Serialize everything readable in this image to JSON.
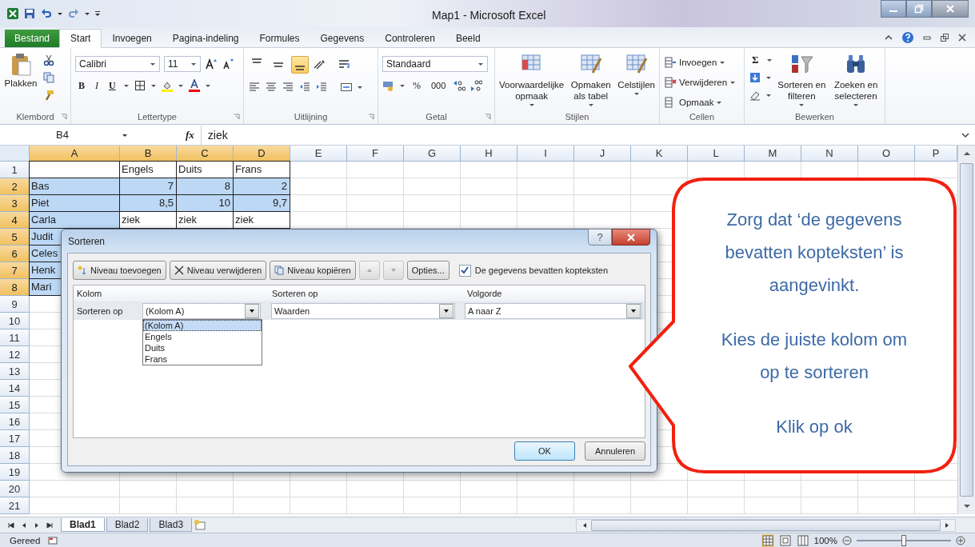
{
  "window": {
    "title": "Map1 - Microsoft Excel"
  },
  "tabs": [
    {
      "label": "Bestand",
      "kind": "file",
      "selected": false
    },
    {
      "label": "Start",
      "kind": "tab",
      "selected": true
    },
    {
      "label": "Invoegen",
      "kind": "tab",
      "selected": false
    },
    {
      "label": "Pagina-indeling",
      "kind": "tab",
      "selected": false
    },
    {
      "label": "Formules",
      "kind": "tab",
      "selected": false
    },
    {
      "label": "Gegevens",
      "kind": "tab",
      "selected": false
    },
    {
      "label": "Controleren",
      "kind": "tab",
      "selected": false
    },
    {
      "label": "Beeld",
      "kind": "tab",
      "selected": false
    }
  ],
  "ribbon": {
    "clipboard": {
      "label": "Klembord",
      "paste": "Plakken"
    },
    "font": {
      "label": "Lettertype",
      "family": "Calibri",
      "size": "11",
      "bold": "B",
      "italic": "I",
      "underline": "U"
    },
    "alignment": {
      "label": "Uitlijning",
      "vertical_align": [
        {
          "selected": false
        },
        {
          "selected": false
        },
        {
          "selected": true
        }
      ]
    },
    "number": {
      "label": "Getal",
      "format": "Standaard",
      "percent": "%",
      "thousands": "000"
    },
    "styles": {
      "label": "Stijlen",
      "buttons": [
        "Voorwaardelijke opmaak",
        "Opmaken als tabel",
        "Celstijlen"
      ]
    },
    "cells": {
      "label": "Cellen",
      "buttons": [
        "Invoegen",
        "Verwijderen",
        "Opmaak"
      ]
    },
    "editing": {
      "label": "Bewerken",
      "autosum": "Σ",
      "buttons": [
        "Sorteren en filteren",
        "Zoeken en selecteren"
      ]
    }
  },
  "formula_bar": {
    "name_box": "B4",
    "fx": "fx",
    "value": "ziek"
  },
  "grid": {
    "columns": [
      {
        "label": "A",
        "selected": true
      },
      {
        "label": "B",
        "selected": true
      },
      {
        "label": "C",
        "selected": true
      },
      {
        "label": "D",
        "selected": true
      },
      {
        "label": "E",
        "selected": false
      },
      {
        "label": "F",
        "selected": false
      },
      {
        "label": "G",
        "selected": false
      },
      {
        "label": "H",
        "selected": false
      },
      {
        "label": "I",
        "selected": false
      },
      {
        "label": "J",
        "selected": false
      },
      {
        "label": "K",
        "selected": false
      },
      {
        "label": "L",
        "selected": false
      },
      {
        "label": "M",
        "selected": false
      },
      {
        "label": "N",
        "selected": false
      },
      {
        "label": "O",
        "selected": false
      },
      {
        "label": "P",
        "selected": false
      }
    ],
    "rows": [
      {
        "label": "1",
        "selected": false,
        "cells": [
          {
            "kind": "text",
            "selected": false
          },
          {
            "text": "Engels",
            "kind": "text",
            "selected": false
          },
          {
            "text": "Duits",
            "kind": "text",
            "selected": false
          },
          {
            "text": "Frans",
            "kind": "text",
            "selected": false
          }
        ]
      },
      {
        "label": "2",
        "selected": true,
        "cells": [
          {
            "text": "Bas",
            "kind": "text",
            "selected": true
          },
          {
            "text": "7",
            "kind": "number",
            "selected": true
          },
          {
            "text": "8",
            "kind": "number",
            "selected": true
          },
          {
            "text": "2",
            "kind": "number",
            "selected": true
          }
        ]
      },
      {
        "label": "3",
        "selected": true,
        "cells": [
          {
            "text": "Piet",
            "kind": "text",
            "selected": true
          },
          {
            "text": "8,5",
            "kind": "number",
            "selected": true
          },
          {
            "text": "10",
            "kind": "number",
            "selected": true
          },
          {
            "text": "9,7",
            "kind": "number",
            "selected": true
          }
        ]
      },
      {
        "label": "4",
        "selected": true,
        "cells": [
          {
            "text": "Carla",
            "kind": "text",
            "selected": true
          },
          {
            "text": "ziek",
            "kind": "text",
            "selected": false
          },
          {
            "text": "ziek",
            "kind": "text",
            "selected": false
          },
          {
            "text": "ziek",
            "kind": "text",
            "selected": false
          }
        ]
      },
      {
        "label": "5",
        "selected": true,
        "cells": [
          {
            "text": "Judit",
            "kind": "text",
            "selected": true
          }
        ]
      },
      {
        "label": "6",
        "selected": true,
        "cells": [
          {
            "text": "Celes",
            "kind": "text",
            "selected": true
          }
        ]
      },
      {
        "label": "7",
        "selected": true,
        "cells": [
          {
            "text": "Henk",
            "kind": "text",
            "selected": true
          }
        ]
      },
      {
        "label": "8",
        "selected": true,
        "cells": [
          {
            "text": "Mari",
            "kind": "text",
            "selected": true
          }
        ]
      },
      {
        "label": "9",
        "selected": false
      },
      {
        "label": "10",
        "selected": false
      },
      {
        "label": "11",
        "selected": false
      },
      {
        "label": "12",
        "selected": false
      },
      {
        "label": "13",
        "selected": false
      },
      {
        "label": "14",
        "selected": false
      },
      {
        "label": "15",
        "selected": false
      },
      {
        "label": "16",
        "selected": false
      },
      {
        "label": "17",
        "selected": false
      },
      {
        "label": "18",
        "selected": false
      },
      {
        "label": "19",
        "selected": false
      },
      {
        "label": "20",
        "selected": false
      },
      {
        "label": "21",
        "selected": false
      }
    ]
  },
  "dialog": {
    "title": "Sorteren",
    "help": "?",
    "toolbar": [
      "Niveau toevoegen",
      "Niveau verwijderen",
      "Niveau kopiëren"
    ],
    "options": "Opties...",
    "has_headers": {
      "label": "De gegevens bevatten kopteksten",
      "checked": true
    },
    "columns": [
      "Kolom",
      "Sorteren op",
      "Volgorde"
    ],
    "level": {
      "label": "Sorteren op",
      "column": "(Kolom A)",
      "sort_on": "Waarden",
      "order": "A naar Z"
    },
    "dropdown": [
      {
        "label": "(Kolom A)",
        "selected": true
      },
      {
        "label": "Engels",
        "selected": false
      },
      {
        "label": "Duits",
        "selected": false
      },
      {
        "label": "Frans",
        "selected": false
      }
    ],
    "buttons": [
      "OK",
      "Annuleren"
    ]
  },
  "callout": {
    "paragraphs": [
      "Zorg dat ‘de gegevens bevatten kopteksten’ is aangevinkt.",
      "Kies de juiste kolom om op te sorteren",
      "Klik op ok"
    ]
  },
  "sheets": [
    {
      "label": "Blad1",
      "selected": true
    },
    {
      "label": "Blad2",
      "selected": false
    },
    {
      "label": "Blad3",
      "selected": false
    }
  ],
  "status_bar": {
    "status": "Gereed",
    "zoom": {
      "reading": "100%",
      "level": 0.5
    }
  }
}
